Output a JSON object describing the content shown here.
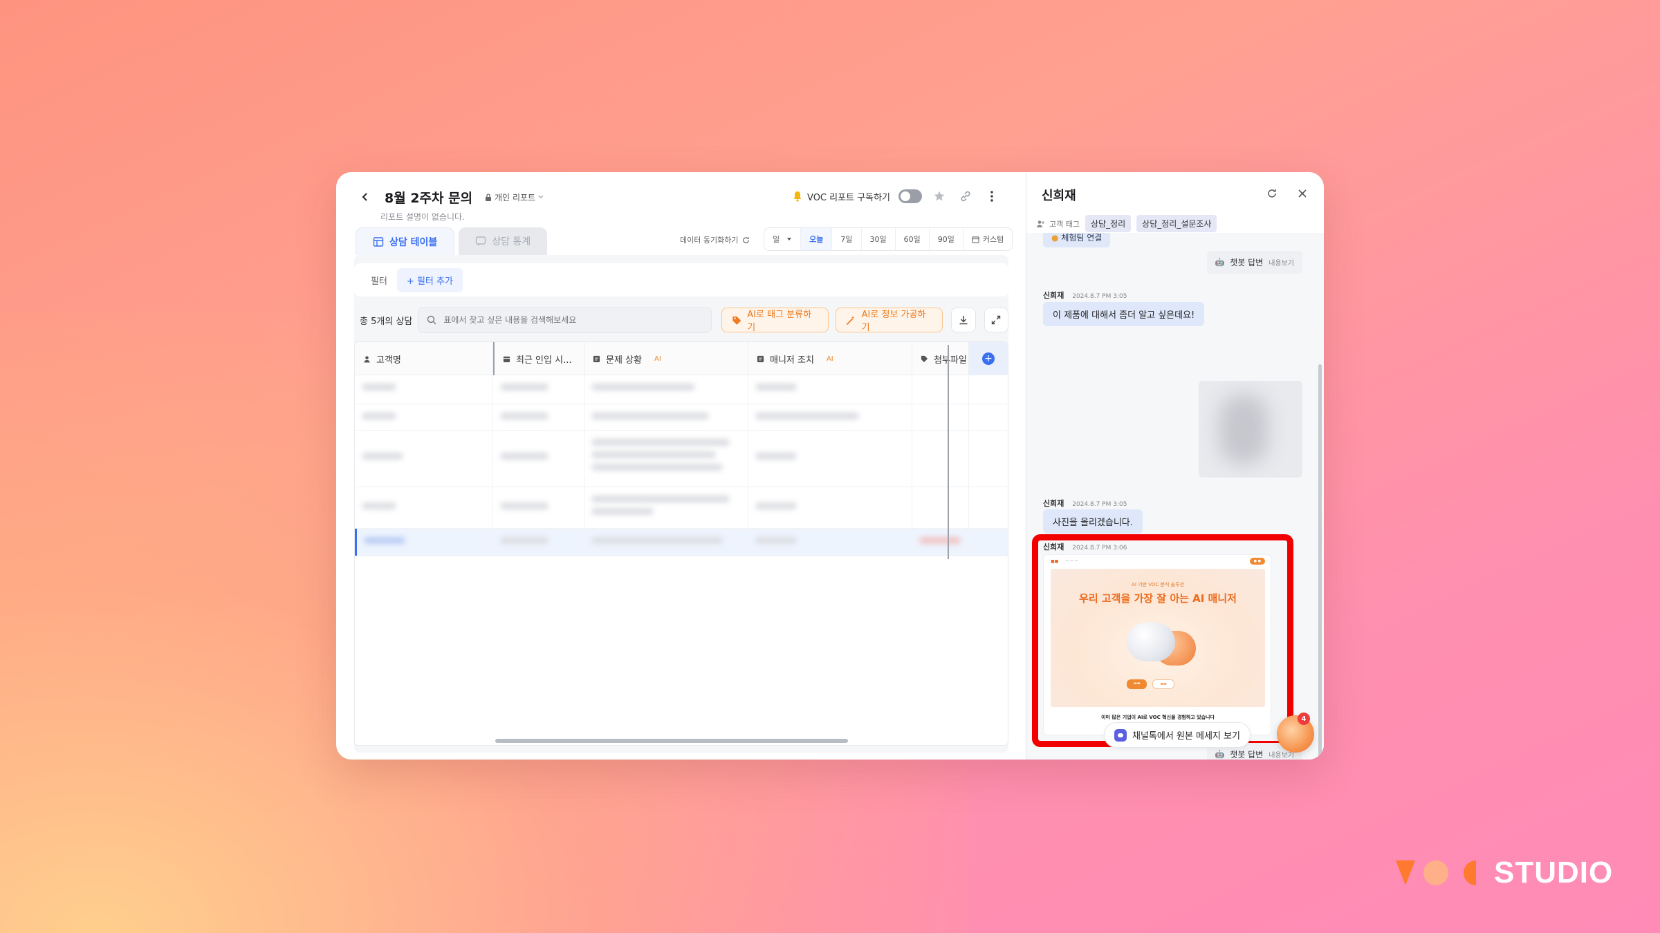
{
  "report": {
    "title": "8월 2주차 문의",
    "privacy": "개인 리포트",
    "description": "리포트 설명이 없습니다."
  },
  "header": {
    "subscribe_label": "VOC 리포트 구독하기",
    "subscribe_on": false
  },
  "tabs": [
    {
      "label": "상담 테이블",
      "active": true
    },
    {
      "label": "상담 통계",
      "active": false
    }
  ],
  "sync_label": "데이터 동기화하기",
  "date_range": {
    "unit": "일",
    "options": [
      "오늘",
      "7일",
      "30일",
      "60일",
      "90일",
      "커스텀"
    ],
    "selected": "오늘"
  },
  "filter": {
    "label": "필터",
    "add_label": "+ 필터 추가"
  },
  "toolbar": {
    "count_label": "총 5개의 상담",
    "search_placeholder": "표에서 찾고 싶은 내용을 검색해보세요",
    "ai_tag_label": "AI로 태그 분류하기",
    "ai_info_label": "AI로 정보 가공하기"
  },
  "table": {
    "columns": [
      {
        "label": "고객명",
        "icon": "person-icon",
        "ai": false
      },
      {
        "label": "최근 인입 시...",
        "icon": "calendar-icon",
        "ai": false
      },
      {
        "label": "문제 상황",
        "icon": "text-icon",
        "ai": true
      },
      {
        "label": "매니저 조치",
        "icon": "text-icon",
        "ai": true
      },
      {
        "label": "첨부파일",
        "icon": "tag-icon",
        "ai": false
      }
    ],
    "ai_badge": "AI",
    "row_count": 5,
    "selected_row": 5
  },
  "chat": {
    "customer_name": "신희재",
    "tag_label": "고객 태그",
    "tags": [
      "상담_정리",
      "상담_정리_설문조사"
    ],
    "top_chip": "체험팀 연결",
    "bot_reply_label": "챗봇 답변",
    "bot_reply_more": "내용보기",
    "messages": [
      {
        "sender": "신희재",
        "time": "2024.8.7 PM 3:05",
        "text": "이 제품에 대해서 좀더 알고 싶은데요!"
      },
      {
        "sender": "신희재",
        "time": "2024.8.7 PM 3:05",
        "text": "사진을 올리겠습니다."
      },
      {
        "sender": "신희재",
        "time": "2024.8.7 PM 3:06",
        "text": ""
      }
    ],
    "attachment": {
      "subtitle": "AI 기반 VOC 분석 솔루션",
      "title": "우리 고객을 가장 잘 아는 AI 매니저",
      "footer": "이미 많은 기업이 AI로 VOC 혁신을 경험하고 있습니다"
    },
    "view_original_label": "채널톡에서 원본 메세지 보기",
    "fab_badge": "4"
  },
  "brand": {
    "wordmark": "STUDIO",
    "colors": {
      "orange": "#ff7a2e",
      "light": "#ffb089"
    }
  },
  "colors": {
    "accent": "#3a6ff0",
    "ai_orange": "#ea7a1e",
    "highlight": "#f20000"
  }
}
